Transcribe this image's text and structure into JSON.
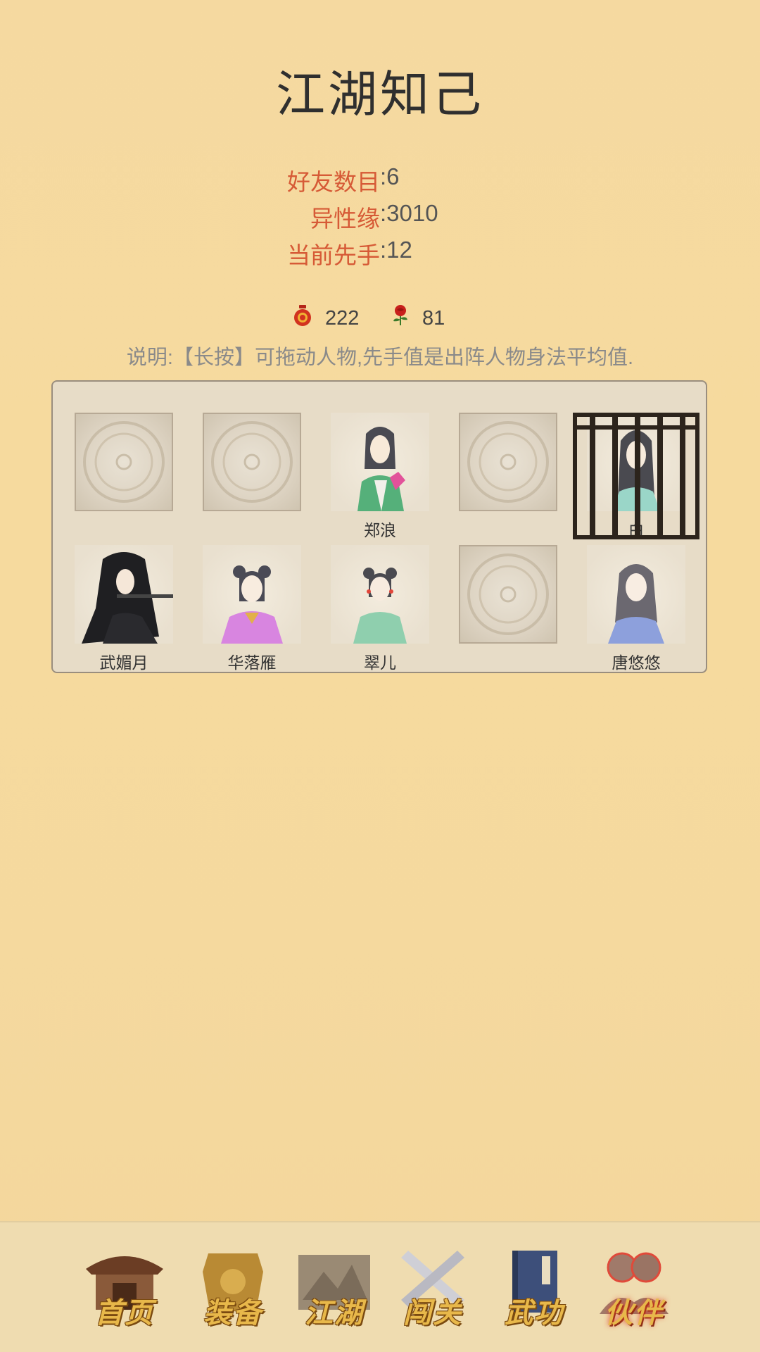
{
  "title": "江湖知己",
  "stats": [
    {
      "label": "好友数目",
      "value": ":6"
    },
    {
      "label": "异性缘",
      "value": ":3010"
    },
    {
      "label": "当前先手",
      "value": ":12"
    }
  ],
  "resources": [
    {
      "icon": "wine-jar-icon",
      "value": "222"
    },
    {
      "icon": "rose-icon",
      "value": "81"
    }
  ],
  "note": "说明:【长按】可拖动人物,先手值是出阵人物身法平均值.",
  "slots_row1": [
    {
      "empty": true,
      "name": ""
    },
    {
      "empty": true,
      "name": ""
    },
    {
      "empty": false,
      "name": "郑浪",
      "portrait": "man-green-robe"
    },
    {
      "empty": true,
      "name": ""
    },
    {
      "empty": false,
      "name": "白",
      "portrait": "woman-jailed",
      "jailed": true
    }
  ],
  "slots_row2": [
    {
      "empty": false,
      "name": "武媚月",
      "portrait": "woman-flute"
    },
    {
      "empty": false,
      "name": "华落雁",
      "portrait": "woman-pink"
    },
    {
      "empty": false,
      "name": "翠儿",
      "portrait": "girl-green"
    },
    {
      "empty": true,
      "name": ""
    },
    {
      "empty": false,
      "name": "唐悠悠",
      "portrait": "woman-blue"
    }
  ],
  "nav": [
    {
      "label": "首页",
      "icon": "house-icon",
      "active": false
    },
    {
      "label": "装备",
      "icon": "armor-icon",
      "active": false
    },
    {
      "label": "江湖",
      "icon": "scroll-map-icon",
      "active": false
    },
    {
      "label": "闯关",
      "icon": "crossed-swords-icon",
      "active": false
    },
    {
      "label": "武功",
      "icon": "book-icon",
      "active": false
    },
    {
      "label": "伙伴",
      "icon": "partners-icon",
      "active": true
    }
  ],
  "colors": {
    "background": "#f5d9a0",
    "label_red": "#d65a36",
    "panel": "#e7dcc7",
    "nav_gold": "#e8b84a"
  }
}
